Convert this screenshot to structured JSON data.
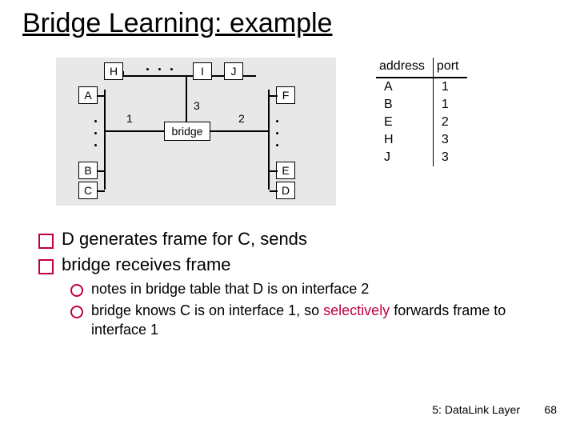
{
  "title": "Bridge Learning: example",
  "diagram": {
    "nodes": {
      "H": "H",
      "I": "I",
      "J": "J",
      "A": "A",
      "F": "F",
      "B": "B",
      "E": "E",
      "C": "C",
      "D": "D"
    },
    "bridge_label": "bridge",
    "ports": {
      "p1": "1",
      "p2": "2",
      "p3": "3"
    }
  },
  "table": {
    "headers": [
      "address",
      "port"
    ],
    "rows": [
      [
        "A",
        "1"
      ],
      [
        "B",
        "1"
      ],
      [
        "E",
        "2"
      ],
      [
        "H",
        "3"
      ],
      [
        "J",
        "3"
      ]
    ]
  },
  "bullets": {
    "b1a": "D generates frame for C, sends",
    "b1b": "bridge receives frame",
    "b2a": "notes in bridge table that D is on interface 2",
    "b2b_pre": "bridge knows C is on interface 1, so ",
    "b2b_hi": "selectively",
    "b2b_post": " forwards frame to interface 1"
  },
  "footer": {
    "label": "5: DataLink Layer",
    "num": "68"
  }
}
